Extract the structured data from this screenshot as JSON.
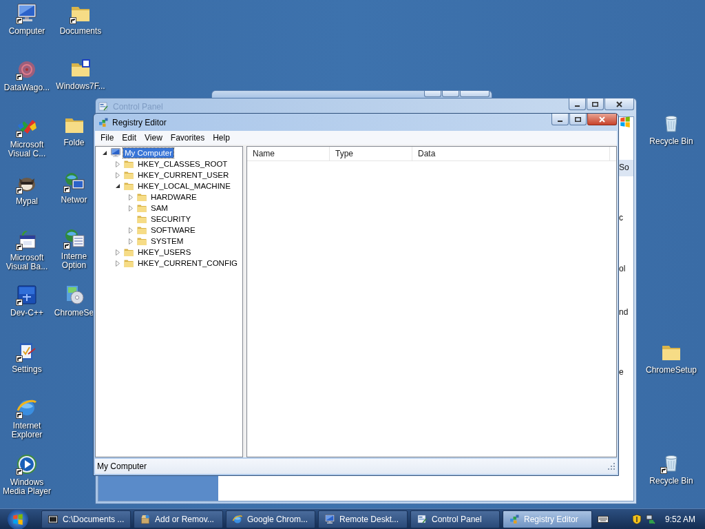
{
  "desktop": {
    "column_1": [
      {
        "label": "Computer",
        "kind": "computer",
        "shortcut": true
      },
      {
        "label": "DataWago...",
        "kind": "disc",
        "shortcut": true
      },
      {
        "label": "Microsoft Visual C...",
        "kind": "app",
        "shortcut": true
      },
      {
        "label": "Mypal",
        "kind": "animal",
        "shortcut": true
      },
      {
        "label": "Microsoft Visual Ba...",
        "kind": "calendar",
        "shortcut": true
      },
      {
        "label": "Dev-C++",
        "kind": "tile",
        "shortcut": true
      },
      {
        "label": "Settings",
        "kind": "clipboard",
        "shortcut": true
      },
      {
        "label": "Internet Explorer",
        "kind": "globe",
        "shortcut": true
      },
      {
        "label": "Windows Media Player",
        "kind": "media",
        "shortcut": true
      }
    ],
    "column_2": [
      {
        "label": "Documents",
        "kind": "folder",
        "shortcut": true
      },
      {
        "label": "Windows7F...",
        "kind": "zip",
        "shortcut": false
      },
      {
        "label": "Folde",
        "kind": "folder",
        "shortcut": false
      },
      {
        "label": "Networ",
        "kind": "globe-monitor",
        "shortcut": true
      },
      {
        "label": "Interne Option",
        "kind": "globe-list",
        "shortcut": true
      },
      {
        "label": "ChromeSe",
        "kind": "cd-box",
        "shortcut": false
      }
    ],
    "column_3": [
      {
        "label": "Recycle Bin",
        "kind": "trash",
        "shortcut": false
      },
      {
        "label": "ChromeSetup",
        "kind": "folder",
        "shortcut": false
      },
      {
        "label": "Recycle Bin",
        "kind": "trash",
        "shortcut": true
      }
    ]
  },
  "control_panel_window": {
    "title": "Control Panel",
    "active": false,
    "fragments": [
      "So",
      "c",
      "ol",
      "nd",
      "e"
    ]
  },
  "registry_editor": {
    "title": "Registry Editor",
    "active": true,
    "menu": [
      "File",
      "Edit",
      "View",
      "Favorites",
      "Help"
    ],
    "tree": [
      {
        "label": "My Computer",
        "selected": true,
        "has_children": true,
        "expanded": true,
        "children": [
          {
            "label": "HKEY_CLASSES_ROOT",
            "selected": false,
            "has_children": true,
            "expanded": false
          },
          {
            "label": "HKEY_CURRENT_USER",
            "selected": false,
            "has_children": true,
            "expanded": false
          },
          {
            "label": "HKEY_LOCAL_MACHINE",
            "selected": false,
            "has_children": true,
            "expanded": true,
            "children": [
              {
                "label": "HARDWARE",
                "selected": false,
                "has_children": true,
                "expanded": false
              },
              {
                "label": "SAM",
                "selected": false,
                "has_children": true,
                "expanded": false
              },
              {
                "label": "SECURITY",
                "selected": false,
                "has_children": false
              },
              {
                "label": "SOFTWARE",
                "selected": false,
                "has_children": true,
                "expanded": false
              },
              {
                "label": "SYSTEM",
                "selected": false,
                "has_children": true,
                "expanded": false
              }
            ]
          },
          {
            "label": "HKEY_USERS",
            "selected": false,
            "has_children": true,
            "expanded": false
          },
          {
            "label": "HKEY_CURRENT_CONFIG",
            "selected": false,
            "has_children": true,
            "expanded": false
          }
        ]
      }
    ],
    "columns": [
      "Name",
      "Type",
      "Data"
    ],
    "status_bar": "My Computer"
  },
  "taskbar": {
    "buttons": [
      {
        "label": "C:\\Documents ...",
        "kind": "archive",
        "selected": false
      },
      {
        "label": "Add or Remov...",
        "kind": "installer",
        "selected": false
      },
      {
        "label": "Google Chrom...",
        "kind": "globe",
        "selected": false
      },
      {
        "label": "Remote Deskt...",
        "kind": "computer",
        "selected": false
      },
      {
        "label": "Control Panel",
        "kind": "panel",
        "selected": false
      },
      {
        "label": "Registry Editor",
        "kind": "cubes",
        "selected": true
      }
    ],
    "clock": "9:52 AM"
  }
}
